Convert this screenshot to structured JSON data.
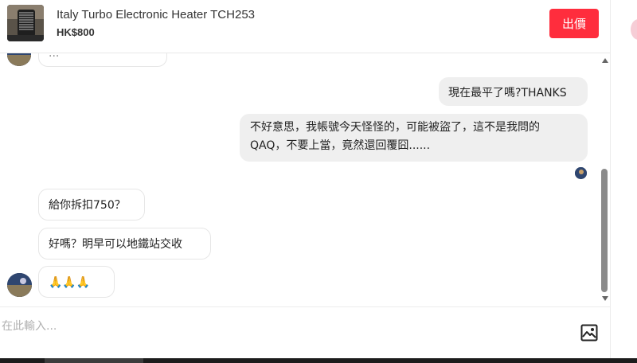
{
  "product": {
    "title": "Italy Turbo Electronic Heater TCH253",
    "price": "HK$800",
    "offer_label": "出價"
  },
  "messages": [
    {
      "side": "in",
      "text": "..."
    },
    {
      "side": "out",
      "text": "現在最平了嗎?THANKS"
    },
    {
      "side": "out",
      "lines": [
        "不好意思，我帳號今天怪怪的，可能被盜了，這不是我問的",
        "QAQ，不要上當，竟然還回覆囧......"
      ]
    },
    {
      "side": "in",
      "text": "給你拆扣750？"
    },
    {
      "side": "in",
      "text": "好嗎？明早可以地鐵站交收"
    },
    {
      "side": "in",
      "text": "🙏🙏🙏"
    }
  ],
  "compose": {
    "placeholder": "在此輸入..."
  },
  "icons": {
    "image_upload": "image-icon"
  },
  "colors": {
    "accent": "#ff2d3d",
    "out_bubble": "#efefef",
    "in_border": "#e6e6e6"
  }
}
